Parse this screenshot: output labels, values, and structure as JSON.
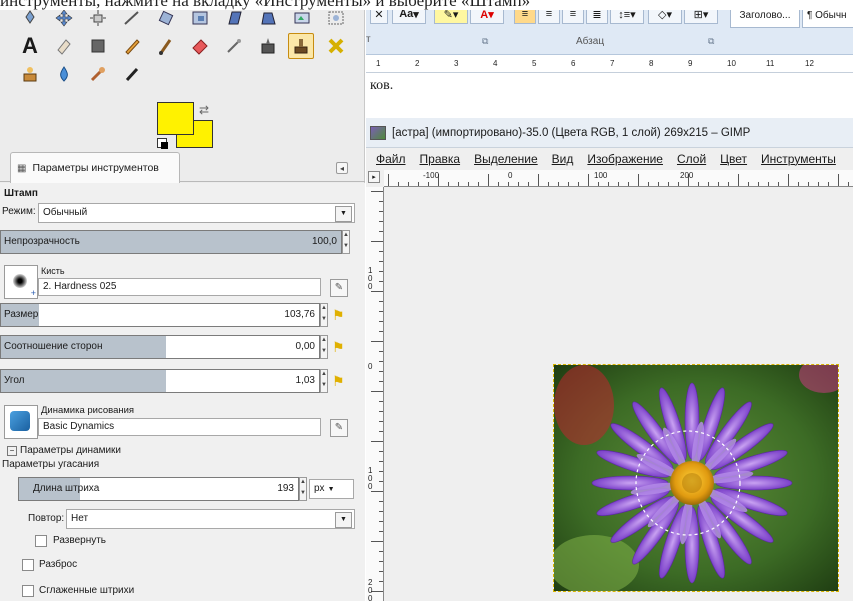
{
  "caption": {
    "text": "инструменты, нажмите на вкладку «Инструменты» и выберите «Штамп»"
  },
  "tool_params": {
    "tab_label": "Параметры инструментов",
    "tool_name": "Штамп",
    "mode_label": "Режим:",
    "mode_value": "Обычный",
    "opacity_label": "Непрозрачность",
    "opacity_value": "100,0",
    "brush_label": "Кисть",
    "brush_value": "2. Hardness 025",
    "size_label": "Размер",
    "size_value": "103,76",
    "aspect_label": "Соотношение сторон",
    "aspect_value": "0,00",
    "angle_label": "Угол",
    "angle_value": "1,03",
    "dynamics_label": "Динамика рисования",
    "dynamics_value": "Basic Dynamics",
    "dynamics_options_label": "Параметры динамики",
    "fade_label": "Параметры угасания",
    "stroke_length_label": "Длина штриха",
    "stroke_length_value": "193",
    "unit_value": "px",
    "repeat_label": "Повтор:",
    "repeat_value": "Нет",
    "reverse_label": "Развернуть",
    "scatter_label": "Разброс",
    "smooth_label": "Сглаженные штрихи"
  },
  "colors": {
    "foreground": "#fff200",
    "background": "#fff200",
    "selection_outline": "#d7b400"
  },
  "ribbon": {
    "font_size_label": "Aa",
    "paragraph_group_label": "Абзац",
    "style_label": "Заголово...",
    "style_label_2": "¶ Обычн",
    "ruler_numbers": [
      "1",
      "2",
      "3",
      "4",
      "5",
      "6",
      "7",
      "8",
      "9",
      "10",
      "11",
      "12"
    ]
  },
  "document": {
    "text": "ков."
  },
  "gimp_window": {
    "title": "[астра] (импортировано)-35.0 (Цвета RGB, 1 слой) 269x215 – GIMP",
    "menu": [
      "Файл",
      "Правка",
      "Выделение",
      "Вид",
      "Изображение",
      "Слой",
      "Цвет",
      "Инструменты"
    ],
    "hruler_labels": [
      "-100",
      "0",
      "100",
      "200"
    ],
    "vruler_labels": [
      "100",
      "0",
      "100",
      "200"
    ]
  }
}
